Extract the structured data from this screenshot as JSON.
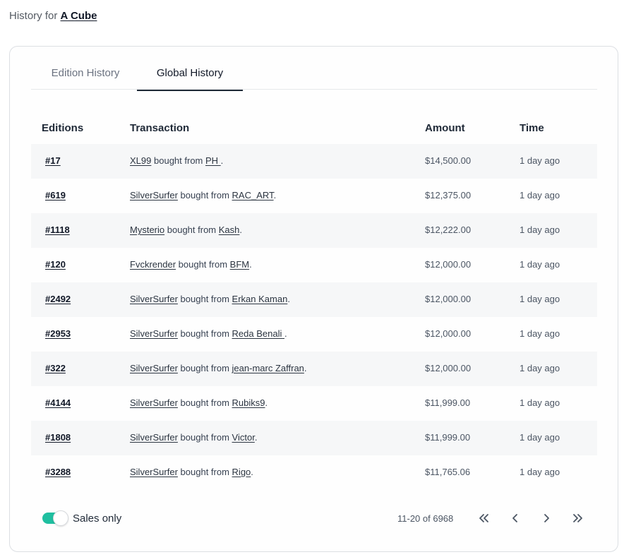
{
  "header": {
    "prefix": "History for",
    "item_name": "A Cube"
  },
  "tabs": [
    {
      "label": "Edition History",
      "active": false
    },
    {
      "label": "Global History",
      "active": true
    }
  ],
  "table": {
    "columns": [
      "Editions",
      "Transaction",
      "Amount",
      "Time"
    ],
    "rows": [
      {
        "edition": "#17",
        "buyer": "XL99",
        "verb": "bought from",
        "seller": "PH ",
        "end": ".",
        "amount": "$14,500.00",
        "time": "1 day ago"
      },
      {
        "edition": "#619",
        "buyer": "SilverSurfer",
        "verb": "bought from",
        "seller": "RAC_ART",
        "end": ".",
        "amount": "$12,375.00",
        "time": "1 day ago"
      },
      {
        "edition": "#1118",
        "buyer": "Mysterio",
        "verb": "bought from",
        "seller": "Kash",
        "end": ".",
        "amount": "$12,222.00",
        "time": "1 day ago"
      },
      {
        "edition": "#120",
        "buyer": "Fvckrender",
        "verb": "bought from",
        "seller": "BFM",
        "end": ".",
        "amount": "$12,000.00",
        "time": "1 day ago"
      },
      {
        "edition": "#2492",
        "buyer": "SilverSurfer",
        "verb": "bought from",
        "seller": "Erkan Kaman",
        "end": ".",
        "amount": "$12,000.00",
        "time": "1 day ago"
      },
      {
        "edition": "#2953",
        "buyer": "SilverSurfer",
        "verb": "bought from",
        "seller": "Reda Benali ",
        "end": ".",
        "amount": "$12,000.00",
        "time": "1 day ago"
      },
      {
        "edition": "#322",
        "buyer": "SilverSurfer",
        "verb": "bought from",
        "seller": "jean-marc Zaffran",
        "end": ".",
        "amount": "$12,000.00",
        "time": "1 day ago"
      },
      {
        "edition": "#4144",
        "buyer": "SilverSurfer",
        "verb": "bought from",
        "seller": "Rubiks9",
        "end": ".",
        "amount": "$11,999.00",
        "time": "1 day ago"
      },
      {
        "edition": "#1808",
        "buyer": "SilverSurfer",
        "verb": "bought from",
        "seller": "Victor",
        "end": ".",
        "amount": "$11,999.00",
        "time": "1 day ago"
      },
      {
        "edition": "#3288",
        "buyer": "SilverSurfer",
        "verb": "bought from",
        "seller": "Rigo",
        "end": ".",
        "amount": "$11,765.06",
        "time": "1 day ago"
      }
    ]
  },
  "footer": {
    "toggle_label": "Sales only",
    "toggle_on": true,
    "range_text": "11-20 of 6968"
  },
  "colors": {
    "toggle_accent": "#1fbfa0",
    "row_shade": "#f6f7f8"
  },
  "icons": [
    "double-chevron-left-icon",
    "chevron-left-icon",
    "chevron-right-icon",
    "double-chevron-right-icon"
  ]
}
